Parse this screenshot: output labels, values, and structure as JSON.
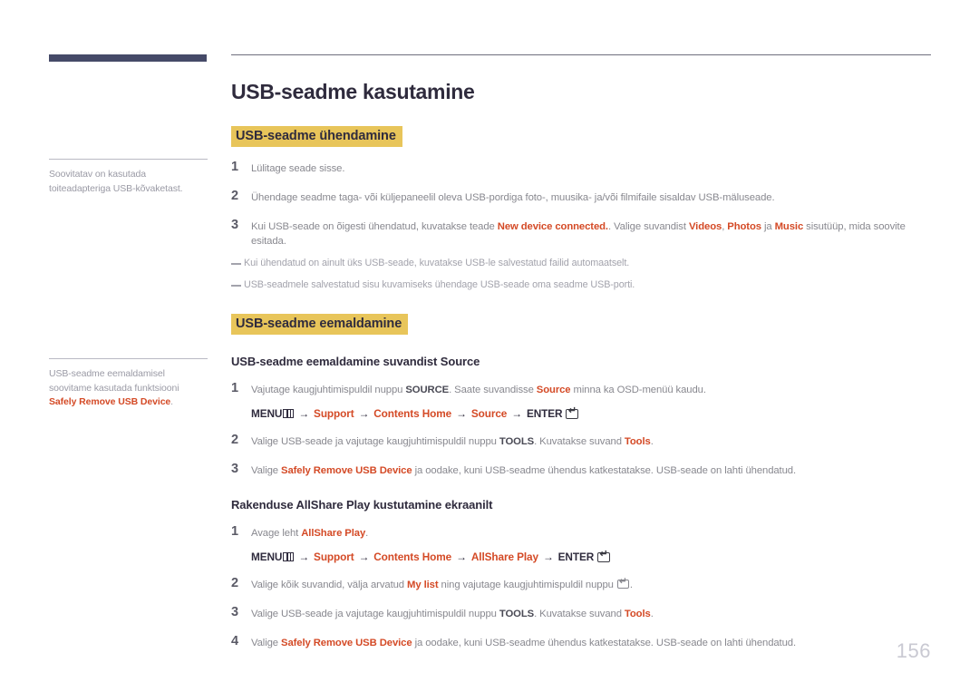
{
  "sidebar": {
    "notes": [
      {
        "text": "Soovitatav on kasutada toiteadapteriga USB-kõvaketast."
      },
      {
        "prefix": "USB-seadme eemaldamisel soovitame kasutada funktsiooni ",
        "accent": "Safely Remove USB Device",
        "suffix": "."
      }
    ]
  },
  "main": {
    "title": "USB-seadme kasutamine",
    "section1": {
      "heading": "USB-seadme ühendamine",
      "steps": [
        {
          "num": "1",
          "text": "Lülitage seade sisse."
        },
        {
          "num": "2",
          "text": "Ühendage seadme taga- või küljepaneelil oleva USB-pordiga foto-, muusika- ja/või filmifaile sisaldav USB-mäluseade."
        },
        {
          "num": "3",
          "parts": [
            {
              "t": "Kui USB-seade on õigesti ühendatud, kuvatakse teade ",
              "style": "normal"
            },
            {
              "t": "New device connected.",
              "style": "accent"
            },
            {
              "t": ". Valige suvandist ",
              "style": "normal"
            },
            {
              "t": "Videos",
              "style": "accent"
            },
            {
              "t": ", ",
              "style": "normal"
            },
            {
              "t": "Photos",
              "style": "accent"
            },
            {
              "t": " ja ",
              "style": "normal"
            },
            {
              "t": "Music",
              "style": "accent"
            },
            {
              "t": " sisutüüp, mida soovite esitada.",
              "style": "normal"
            }
          ]
        }
      ],
      "notes": [
        "Kui ühendatud on ainult üks USB-seade, kuvatakse USB-le salvestatud failid automaatselt.",
        "USB-seadmele salvestatud sisu kuvamiseks ühendage USB-seade oma seadme USB-porti."
      ]
    },
    "section2": {
      "heading": "USB-seadme eemaldamine",
      "sub1": {
        "title": "USB-seadme eemaldamine suvandist Source",
        "steps": [
          {
            "num": "1",
            "parts": [
              {
                "t": "Vajutage kaugjuhtimispuldil nuppu ",
                "style": "normal"
              },
              {
                "t": "SOURCE",
                "style": "key"
              },
              {
                "t": ". Saate suvandisse ",
                "style": "normal"
              },
              {
                "t": "Source",
                "style": "accent"
              },
              {
                "t": " minna ka OSD-menüü kaudu.",
                "style": "normal"
              }
            ],
            "menu_path": {
              "menu_label": "MENU",
              "segments": [
                "Support",
                "Contents Home",
                "Source"
              ],
              "enter_label": "ENTER"
            }
          },
          {
            "num": "2",
            "parts": [
              {
                "t": "Valige USB-seade ja vajutage kaugjuhtimispuldil nuppu ",
                "style": "normal"
              },
              {
                "t": "TOOLS",
                "style": "key"
              },
              {
                "t": ". Kuvatakse suvand ",
                "style": "normal"
              },
              {
                "t": "Tools",
                "style": "accent"
              },
              {
                "t": ".",
                "style": "normal"
              }
            ]
          },
          {
            "num": "3",
            "parts": [
              {
                "t": "Valige ",
                "style": "normal"
              },
              {
                "t": "Safely Remove USB Device",
                "style": "accent"
              },
              {
                "t": " ja oodake, kuni USB-seadme ühendus katkestatakse. USB-seade on lahti ühendatud.",
                "style": "normal"
              }
            ]
          }
        ]
      },
      "sub2": {
        "title": "Rakenduse AllShare Play kustutamine ekraanilt",
        "steps": [
          {
            "num": "1",
            "parts": [
              {
                "t": "Avage leht ",
                "style": "normal"
              },
              {
                "t": "AllShare Play",
                "style": "accent"
              },
              {
                "t": ".",
                "style": "normal"
              }
            ],
            "menu_path": {
              "menu_label": "MENU",
              "segments": [
                "Support",
                "Contents Home",
                "AllShare Play"
              ],
              "enter_label": "ENTER"
            }
          },
          {
            "num": "2",
            "parts": [
              {
                "t": "Valige kõik suvandid, välja arvatud ",
                "style": "normal"
              },
              {
                "t": "My list",
                "style": "accent"
              },
              {
                "t": " ning vajutage kaugjuhtimispuldil nuppu ",
                "style": "normal"
              },
              {
                "t": "",
                "style": "enter-icon"
              },
              {
                "t": ".",
                "style": "normal"
              }
            ]
          },
          {
            "num": "3",
            "parts": [
              {
                "t": "Valige USB-seade ja vajutage kaugjuhtimispuldil nuppu ",
                "style": "normal"
              },
              {
                "t": "TOOLS",
                "style": "key"
              },
              {
                "t": ". Kuvatakse suvand ",
                "style": "normal"
              },
              {
                "t": "Tools",
                "style": "accent"
              },
              {
                "t": ".",
                "style": "normal"
              }
            ]
          },
          {
            "num": "4",
            "parts": [
              {
                "t": "Valige ",
                "style": "normal"
              },
              {
                "t": "Safely Remove USB Device",
                "style": "accent"
              },
              {
                "t": " ja oodake, kuni USB-seadme ühendus katkestatakse. USB-seade on lahti ühendatud.",
                "style": "normal"
              }
            ]
          }
        ]
      }
    }
  },
  "footer": {
    "page_number": "156"
  },
  "colors": {
    "accent": "#d44a26",
    "highlight": "#e8c55a",
    "sidebar_bar": "#454a68",
    "heading": "#2f2b3d"
  }
}
